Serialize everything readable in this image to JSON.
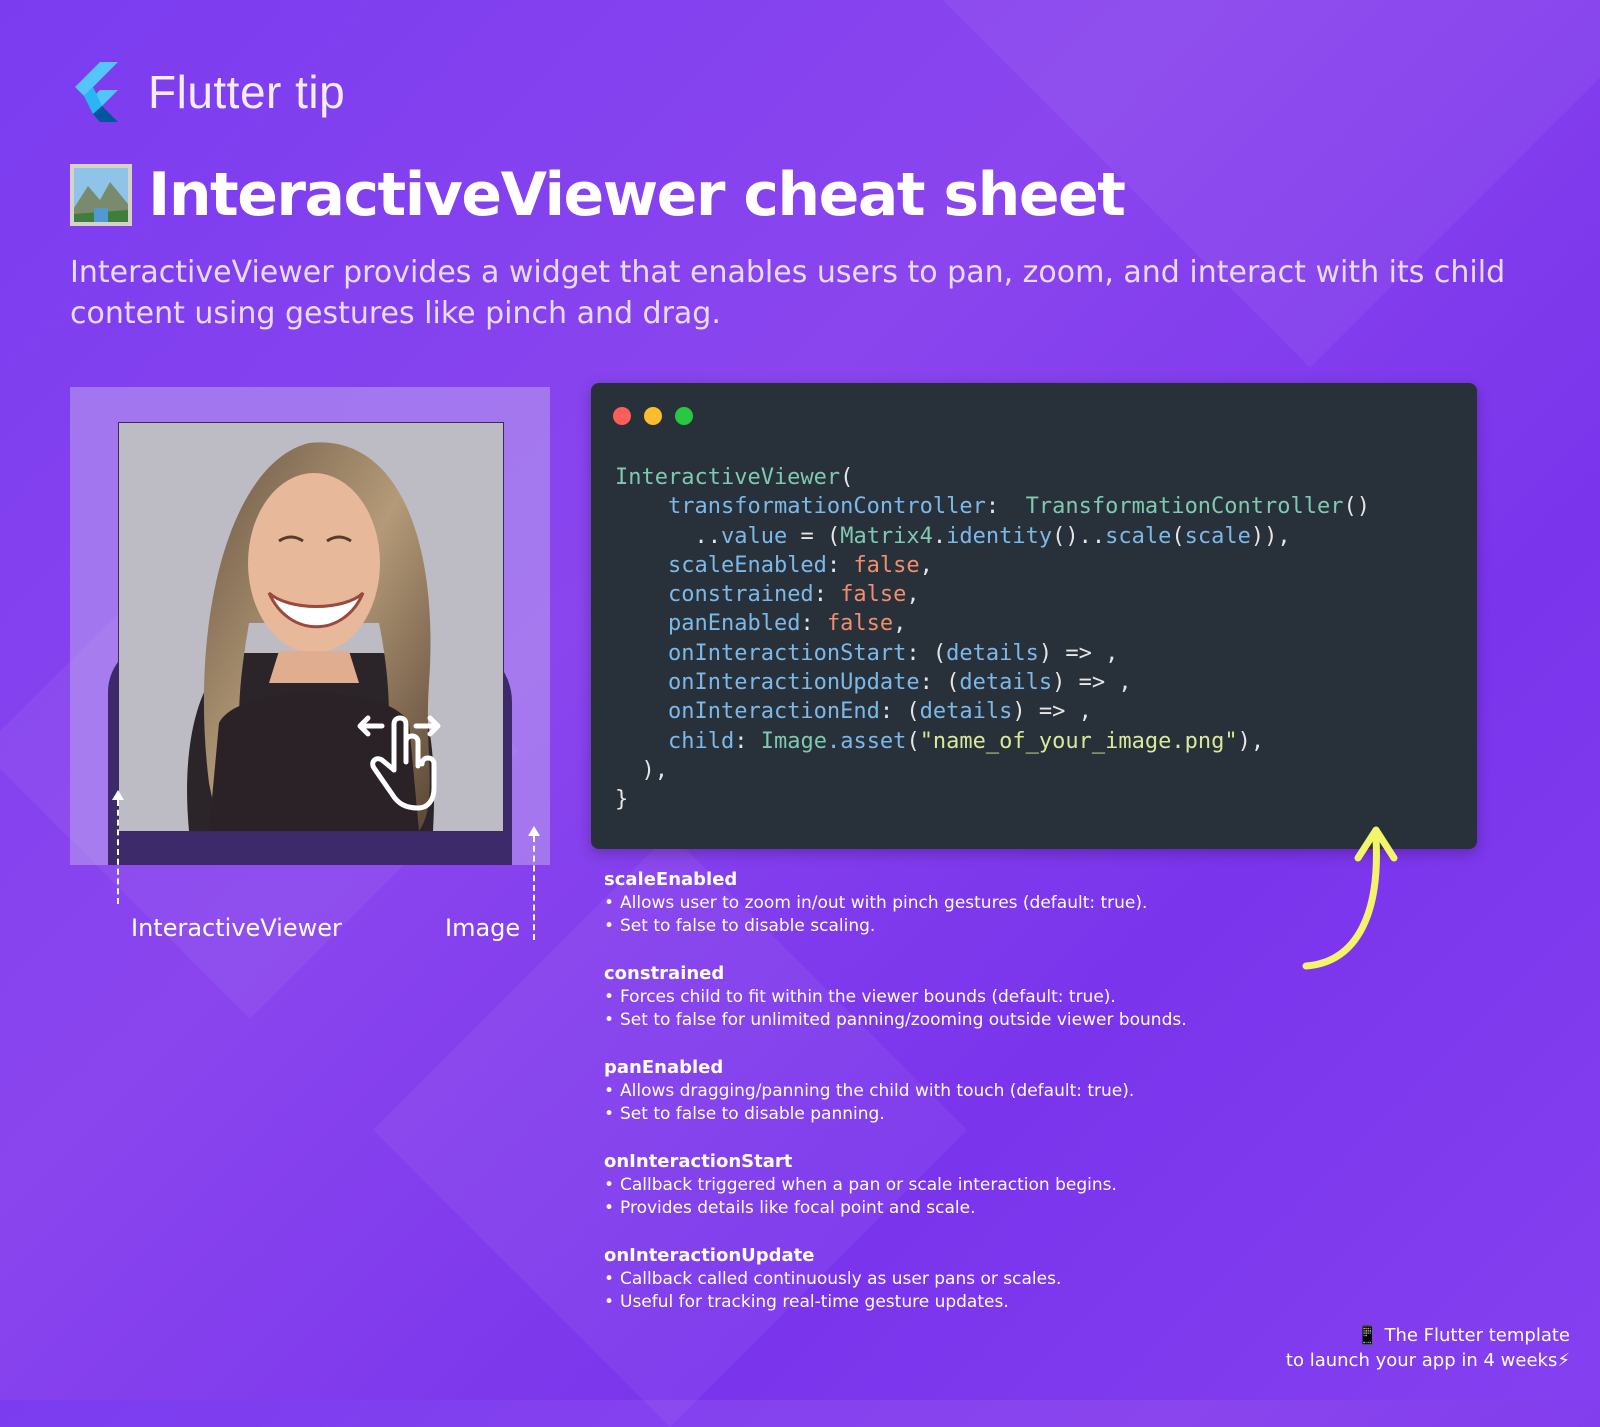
{
  "header": {
    "brand": "Flutter tip"
  },
  "title": "InteractiveViewer cheat sheet",
  "subtitle": "InteractiveViewer provides a widget that enables users to pan, zoom, and interact with its child content using gestures like pinch and drag.",
  "diagram": {
    "label_viewer": "InteractiveViewer",
    "label_image": "Image"
  },
  "code": {
    "l1_cls": "InteractiveViewer",
    "l1_p": "(",
    "l2_prop": "transformationController",
    "l2_p": ":  ",
    "l2_cls": "TransformationController",
    "l2_end": "()",
    "l3_a": "..",
    "l3_prop": "value",
    "l3_b": " = (",
    "l3_cls": "Matrix4",
    "l3_c": ".",
    "l3_m": "identity",
    "l3_d": "()..",
    "l3_m2": "scale",
    "l3_e": "(",
    "l3_arg": "scale",
    "l3_f": ")),",
    "l4_prop": "scaleEnabled",
    "l5_prop": "constrained",
    "l6_prop": "panEnabled",
    "colon": ": ",
    "false_kw": "false",
    "comma": ",",
    "l7_prop": "onInteractionStart",
    "l8_prop": "onInteractionUpdate",
    "l9_prop": "onInteractionEnd",
    "p_open": ": (",
    "details": "details",
    "arrow": ") => ,",
    "l10_prop": "child",
    "l10_cls": "Image",
    "l10_m": ".asset",
    "l10_o": "(",
    "l10_str": "\"name_of_your_image.png\"",
    "l10_e": "),",
    "l11": "),",
    "l12": "}"
  },
  "notes": [
    {
      "title": "scaleEnabled",
      "bullets": [
        "Allows user to zoom in/out with pinch gestures (default: true).",
        "Set to false to disable scaling."
      ]
    },
    {
      "title": "constrained",
      "bullets": [
        "Forces child to fit within the viewer bounds (default: true).",
        "Set to false for unlimited panning/zooming outside viewer bounds."
      ]
    },
    {
      "title": "panEnabled",
      "bullets": [
        "Allows dragging/panning the child with touch (default: true).",
        "Set to false to disable panning."
      ]
    },
    {
      "title": "onInteractionStart",
      "bullets": [
        "Callback triggered when a pan or scale interaction begins.",
        "Provides details like focal point and scale."
      ]
    },
    {
      "title": "onInteractionUpdate",
      "bullets": [
        "Callback called continuously as user pans or scales.",
        "Useful for tracking real-time gesture updates."
      ]
    }
  ],
  "footer": {
    "line1": "📱 The Flutter template",
    "line2": "to launch your app in 4 weeks⚡"
  },
  "colors": {
    "bg": "#7b3cf0",
    "code_bg": "#28303a",
    "arrow": "#f2f56a"
  },
  "icons": [
    "flutter-logo-icon",
    "framed-picture-icon",
    "pinch-gesture-icon"
  ]
}
